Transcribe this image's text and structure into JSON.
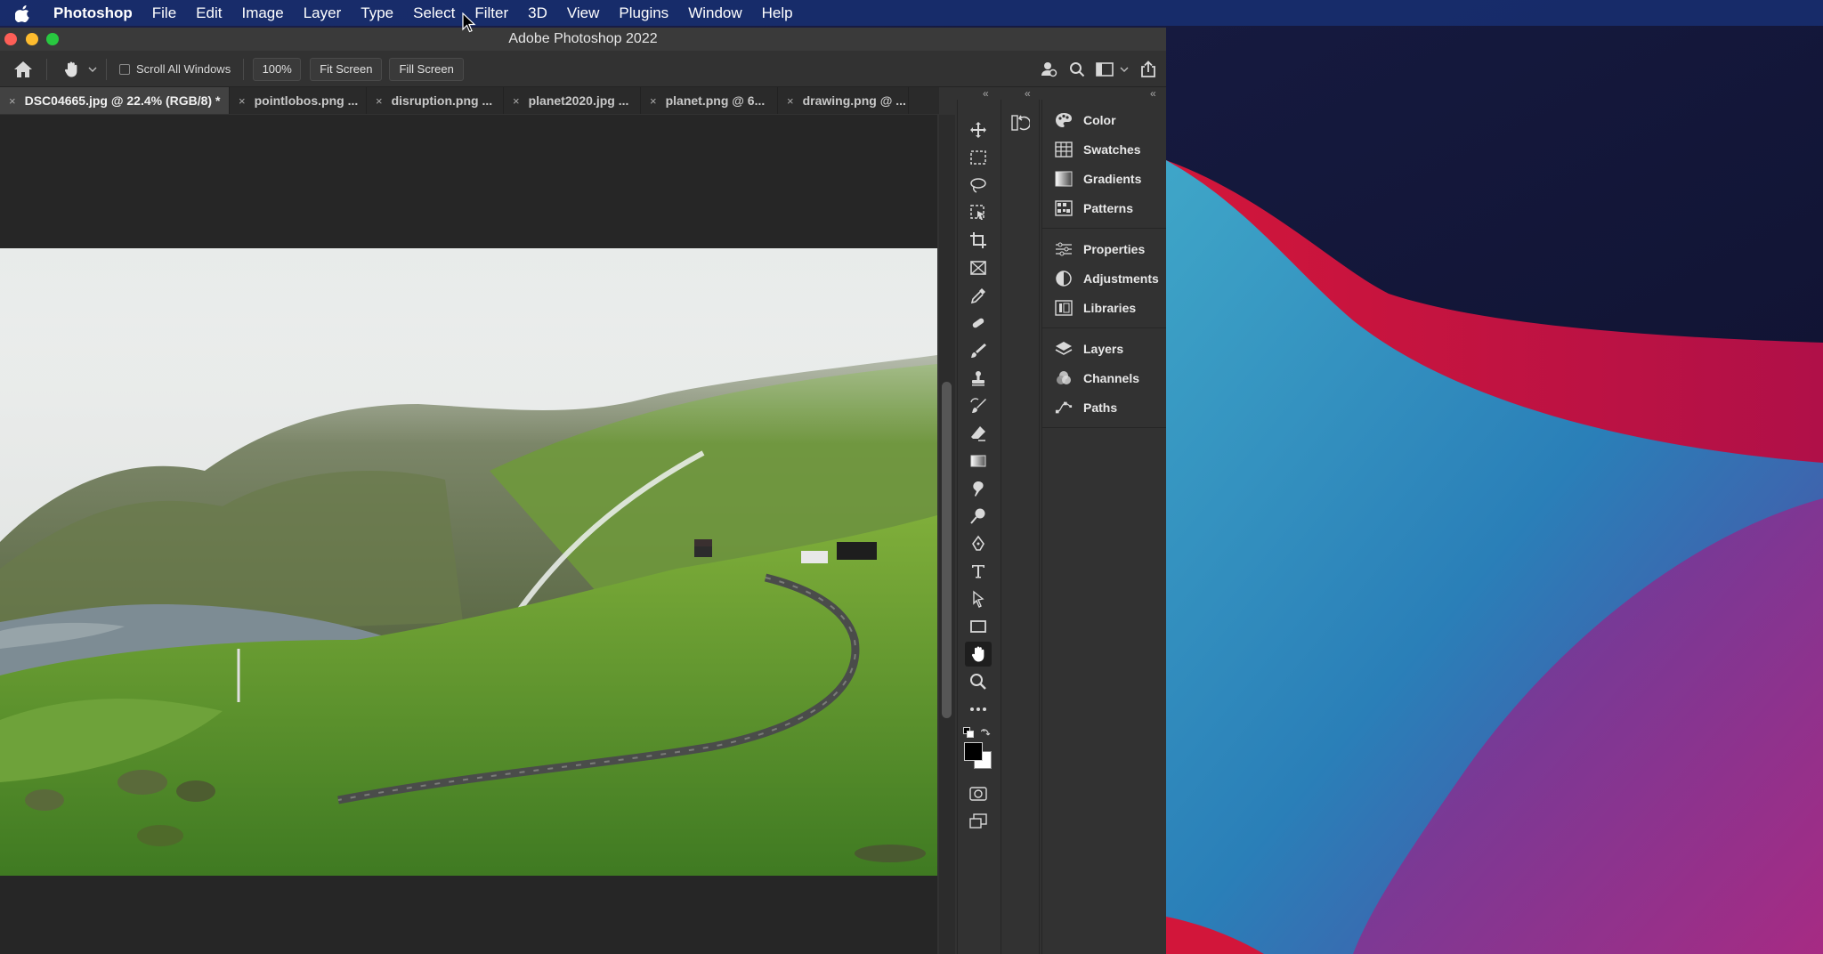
{
  "menubar": {
    "app_name": "Photoshop",
    "items": [
      "File",
      "Edit",
      "Image",
      "Layer",
      "Type",
      "Select",
      "Filter",
      "3D",
      "View",
      "Plugins",
      "Window",
      "Help"
    ]
  },
  "window": {
    "title": "Adobe Photoshop 2022"
  },
  "options_bar": {
    "scroll_all_windows_label": "Scroll All Windows",
    "scroll_all_windows_checked": false,
    "zoom_value": "100%",
    "fit_screen_label": "Fit Screen",
    "fill_screen_label": "Fill Screen"
  },
  "tabs": [
    {
      "label": "DSC04665.jpg @ 22.4% (RGB/8) *",
      "active": true
    },
    {
      "label": "pointlobos.png ...",
      "active": false
    },
    {
      "label": "disruption.png ...",
      "active": false
    },
    {
      "label": "planet2020.jpg ...",
      "active": false
    },
    {
      "label": "planet.png @ 6...",
      "active": false
    },
    {
      "label": "drawing.png @ ...",
      "active": false
    }
  ],
  "tools": [
    "move-tool",
    "marquee-tool",
    "lasso-tool",
    "object-select-tool",
    "crop-tool",
    "frame-tool",
    "eyedropper-tool",
    "healing-brush-tool",
    "brush-tool",
    "clone-stamp-tool",
    "history-brush-tool",
    "eraser-tool",
    "gradient-tool",
    "smudge-tool",
    "dodge-tool",
    "pen-tool",
    "type-tool",
    "path-selection-tool",
    "rectangle-tool",
    "hand-tool",
    "zoom-tool",
    "more-tools"
  ],
  "active_tool": "hand-tool",
  "colors": {
    "foreground": "#000000",
    "background": "#ffffff"
  },
  "panels": {
    "group1": [
      "Color",
      "Swatches",
      "Gradients",
      "Patterns"
    ],
    "group2": [
      "Properties",
      "Adjustments",
      "Libraries"
    ],
    "group3": [
      "Layers",
      "Channels",
      "Paths"
    ]
  }
}
